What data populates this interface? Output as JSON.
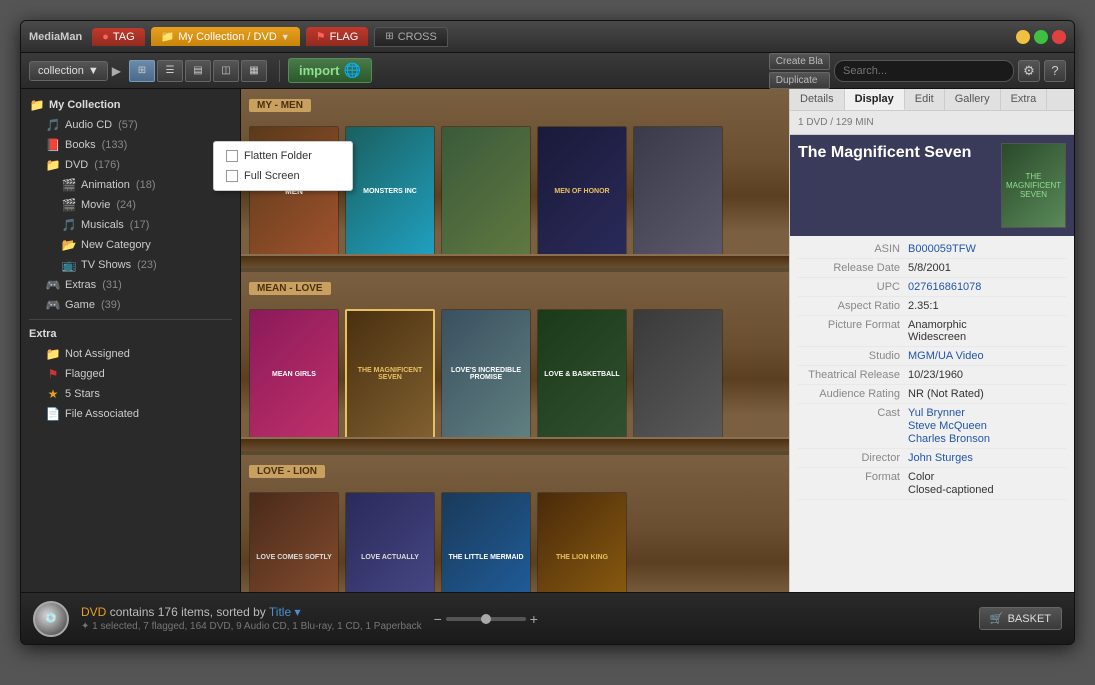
{
  "window": {
    "title": "MediaMan",
    "controls": {
      "minimize": "−",
      "maximize": "□",
      "close": "✕"
    }
  },
  "tabs": [
    {
      "id": "tag",
      "label": "TAG",
      "type": "tag"
    },
    {
      "id": "collection",
      "label": "My Collection / DVD",
      "type": "collection"
    },
    {
      "id": "flag",
      "label": "FLAG",
      "type": "flag"
    },
    {
      "id": "cross",
      "label": "CROSS",
      "type": "cross"
    }
  ],
  "toolbar": {
    "collection_label": "collection",
    "dropdown_arrow": "▼",
    "nav_arrow": "▶",
    "views": [
      "⊞",
      "☰",
      "▤",
      "◫",
      "▦"
    ],
    "import_label": "import",
    "create_label": "Create Bla",
    "duplicate_label": "Duplicate",
    "search_placeholder": "Search...",
    "dropdown": {
      "flatten_folder": "Flatten Folder",
      "full_screen": "Full Screen"
    }
  },
  "sidebar": {
    "root": "My Collection",
    "items": [
      {
        "id": "audio-cd",
        "label": "Audio CD",
        "count": "(57)",
        "indent": 1
      },
      {
        "id": "books",
        "label": "Books",
        "count": "(133)",
        "indent": 1
      },
      {
        "id": "dvd",
        "label": "DVD",
        "count": "(176)",
        "indent": 1
      },
      {
        "id": "animation",
        "label": "Animation",
        "count": "(18)",
        "indent": 2
      },
      {
        "id": "movie",
        "label": "Movie",
        "count": "(24)",
        "indent": 2
      },
      {
        "id": "musicals",
        "label": "Musicals",
        "count": "(17)",
        "indent": 2
      },
      {
        "id": "new-category",
        "label": "New Category",
        "count": "",
        "indent": 2
      },
      {
        "id": "tv-shows",
        "label": "TV Shows",
        "count": "(23)",
        "indent": 2
      },
      {
        "id": "extras",
        "label": "Extras",
        "count": "(31)",
        "indent": 1
      },
      {
        "id": "game",
        "label": "Game",
        "count": "(39)",
        "indent": 1
      }
    ],
    "extra_section": "Extra",
    "extra_items": [
      {
        "id": "not-assigned",
        "label": "Not Assigned",
        "icon": "folder"
      },
      {
        "id": "flagged",
        "label": "Flagged",
        "icon": "flag"
      },
      {
        "id": "5-stars",
        "label": "5 Stars",
        "icon": "star"
      },
      {
        "id": "file-associated",
        "label": "File Associated",
        "icon": "file"
      }
    ]
  },
  "shelves": [
    {
      "label": "MY - MEN",
      "books": [
        {
          "title": "Men",
          "color": "brown"
        },
        {
          "title": "Monsters Inc",
          "color": "blue"
        },
        {
          "title": "",
          "color": "teal"
        },
        {
          "title": "Men of Honor",
          "color": "red"
        },
        {
          "title": "",
          "color": "orange"
        }
      ]
    },
    {
      "label": "MEAN - LOVE",
      "books": [
        {
          "title": "Mean Girls",
          "color": "pink"
        },
        {
          "title": "The Magnificent Seven",
          "color": "brown"
        },
        {
          "title": "Love's Incredible Promise",
          "color": "green"
        },
        {
          "title": "Love & Basketball",
          "color": "red"
        },
        {
          "title": "",
          "color": "gray"
        }
      ]
    },
    {
      "label": "LOVE - LION",
      "books": [
        {
          "title": "Love Comes Softly",
          "color": "orange"
        },
        {
          "title": "Love Actually",
          "color": "blue"
        },
        {
          "title": "The Little Mermaid",
          "color": "teal"
        },
        {
          "title": "The Lion King",
          "color": "red"
        }
      ]
    }
  ],
  "detail": {
    "tabs": [
      "Details",
      "Display",
      "Edit",
      "Gallery",
      "Extra"
    ],
    "active_tab": "Display",
    "header": "1 DVD / 129 MIN",
    "title": "The Magnificent Seven",
    "fields": [
      {
        "label": "ASIN",
        "value": "B000059TFW",
        "link": true
      },
      {
        "label": "Release Date",
        "value": "5/8/2001",
        "link": false
      },
      {
        "label": "UPC",
        "value": "027616861078",
        "link": true
      },
      {
        "label": "Aspect Ratio",
        "value": "2.35:1",
        "link": false
      },
      {
        "label": "Picture Format",
        "value": "Anamorphic Widescreen",
        "link": false
      },
      {
        "label": "Studio",
        "value": "MGM/UA Video",
        "link": true
      },
      {
        "label": "Theatrical Release",
        "value": "10/23/1960",
        "link": false
      },
      {
        "label": "Audience Rating",
        "value": "NR (Not Rated)",
        "link": false
      },
      {
        "label": "Cast",
        "value": "Yul Brynner\nSteve McQueen\nCharles Bronson",
        "link": true
      },
      {
        "label": "Director",
        "value": "John Sturges",
        "link": true
      },
      {
        "label": "Format",
        "value": "Color\nClosed-captioned",
        "link": false
      }
    ]
  },
  "statusbar": {
    "dvd_label": "DVD",
    "contains": "contains 176 items, sorted by",
    "sort_field": "Title",
    "sort_arrow": "▾",
    "substatus": "✦  1 selected, 7 flagged, 164 DVD, 9 Audio CD, 1 Blu-ray, 1 CD, 1 Paperback",
    "basket_label": "BASKET"
  }
}
